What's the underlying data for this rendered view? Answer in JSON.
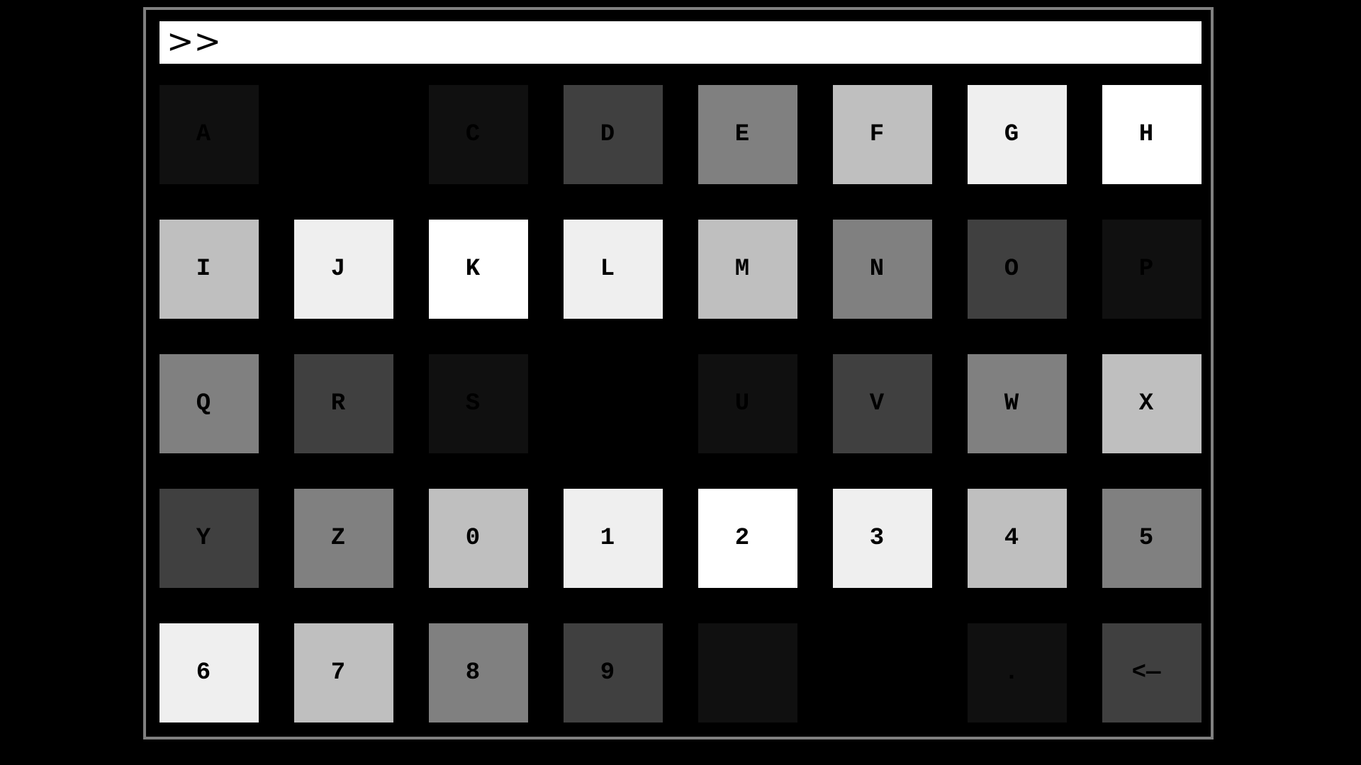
{
  "prompt": ">>",
  "keys": [
    {
      "label": "A",
      "color": "#101010"
    },
    {
      "label": "",
      "color": "#000000"
    },
    {
      "label": "C",
      "color": "#101010"
    },
    {
      "label": "D",
      "color": "#404040"
    },
    {
      "label": "E",
      "color": "#808080"
    },
    {
      "label": "F",
      "color": "#bfbfbf"
    },
    {
      "label": "G",
      "color": "#efefef"
    },
    {
      "label": "H",
      "color": "#ffffff"
    },
    {
      "label": "I",
      "color": "#bfbfbf"
    },
    {
      "label": "J",
      "color": "#efefef"
    },
    {
      "label": "K",
      "color": "#ffffff"
    },
    {
      "label": "L",
      "color": "#efefef"
    },
    {
      "label": "M",
      "color": "#bfbfbf"
    },
    {
      "label": "N",
      "color": "#808080"
    },
    {
      "label": "O",
      "color": "#404040"
    },
    {
      "label": "P",
      "color": "#101010"
    },
    {
      "label": "Q",
      "color": "#808080"
    },
    {
      "label": "R",
      "color": "#404040"
    },
    {
      "label": "S",
      "color": "#101010"
    },
    {
      "label": "",
      "color": "#000000"
    },
    {
      "label": "U",
      "color": "#101010"
    },
    {
      "label": "V",
      "color": "#404040"
    },
    {
      "label": "W",
      "color": "#808080"
    },
    {
      "label": "X",
      "color": "#bfbfbf"
    },
    {
      "label": "Y",
      "color": "#404040"
    },
    {
      "label": "Z",
      "color": "#808080"
    },
    {
      "label": "0",
      "color": "#bfbfbf"
    },
    {
      "label": "1",
      "color": "#efefef"
    },
    {
      "label": "2",
      "color": "#ffffff"
    },
    {
      "label": "3",
      "color": "#efefef"
    },
    {
      "label": "4",
      "color": "#bfbfbf"
    },
    {
      "label": "5",
      "color": "#808080"
    },
    {
      "label": "6",
      "color": "#efefef"
    },
    {
      "label": "7",
      "color": "#bfbfbf"
    },
    {
      "label": "8",
      "color": "#808080"
    },
    {
      "label": "9",
      "color": "#404040"
    },
    {
      "label": "",
      "color": "#101010"
    },
    {
      "label": "",
      "color": "#000000"
    },
    {
      "label": ".",
      "color": "#101010"
    },
    {
      "label": "<—",
      "color": "#404040"
    }
  ]
}
